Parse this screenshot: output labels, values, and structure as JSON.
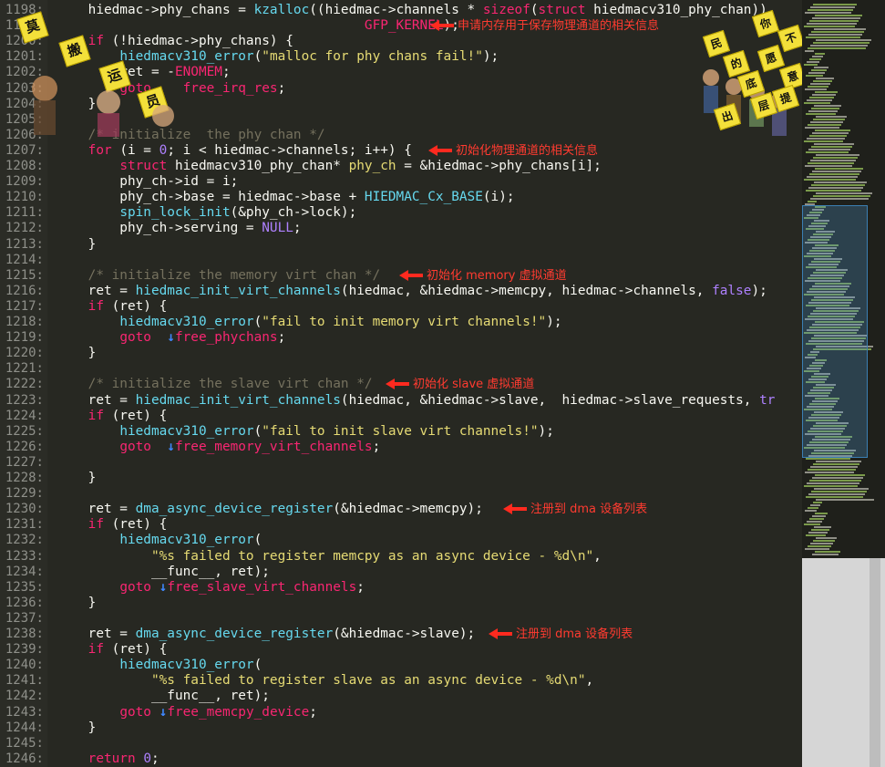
{
  "lines": [
    {
      "n": "1198:",
      "html": "    hiedmac->phy_chans = <span class='fn'>kzalloc</span>((hiedmac->channels * <span class='kw'>sizeof</span>(<span class='kw'>struct</span> hiedmacv310_phy_chan)),"
    },
    {
      "n": "1199:",
      "html": "                                       <span class='kw'>GFP_KERNEL</span>);"
    },
    {
      "n": "1200:",
      "html": "    <span class='kw'>if</span> (!hiedmac->phy_chans) {"
    },
    {
      "n": "1201:",
      "html": "        <span class='fn'>hiedmacv310_error</span>(<span class='str'>\"malloc for phy chans fail!\"</span>);"
    },
    {
      "n": "1202:",
      "html": "        ret = -<span class='kw'>ENOMEM</span>;"
    },
    {
      "n": "1203:",
      "html": "        <span class='kw'>goto</span>    <span class='lbl'>free_irq_res</span>;"
    },
    {
      "n": "1204:",
      "html": "    }"
    },
    {
      "n": "1205:",
      "html": ""
    },
    {
      "n": "1206:",
      "html": "    <span class='cm'>/* initialize  the phy chan */</span>"
    },
    {
      "n": "1207:",
      "html": "    <span class='kw'>for</span> (i = <span class='num'>0</span>; i &lt; hiedmac->channels; i++) {"
    },
    {
      "n": "1208:",
      "html": "        <span class='kw'>struct</span> hiedmacv310_phy_chan* <span class='str'>phy_ch</span> = &amp;hiedmac->phy_chans[i];"
    },
    {
      "n": "1209:",
      "html": "        phy_ch->id = i;"
    },
    {
      "n": "1210:",
      "html": "        phy_ch->base = hiedmac->base + <span class='mac'>HIEDMAC_Cx_BASE</span>(i);"
    },
    {
      "n": "1211:",
      "html": "        <span class='fn'>spin_lock_init</span>(&amp;phy_ch->lock);"
    },
    {
      "n": "1212:",
      "html": "        phy_ch->serving = <span class='cst'>NULL</span>;"
    },
    {
      "n": "1213:",
      "html": "    }"
    },
    {
      "n": "1214:",
      "html": ""
    },
    {
      "n": "1215:",
      "html": "    <span class='cm'>/* initialize the memory virt chan */</span>"
    },
    {
      "n": "1216:",
      "html": "    ret = <span class='fn'>hiedmac_init_virt_channels</span>(hiedmac, &amp;hiedmac->memcpy, hiedmac->channels, <span class='cst'>false</span>);"
    },
    {
      "n": "1217:",
      "html": "    <span class='kw'>if</span> (ret) {"
    },
    {
      "n": "1218:",
      "html": "        <span class='fn'>hiedmacv310_error</span>(<span class='str'>\"fail to init memory virt channels!\"</span>);"
    },
    {
      "n": "1219:",
      "html": "        <span class='kw'>goto</span>  <span class='gt'>↓</span><span class='lbl'>free_phychans</span>;"
    },
    {
      "n": "1220:",
      "html": "    }"
    },
    {
      "n": "1221:",
      "html": ""
    },
    {
      "n": "1222:",
      "html": "    <span class='cm'>/* initialize the slave virt chan */</span>"
    },
    {
      "n": "1223:",
      "html": "    ret = <span class='fn'>hiedmac_init_virt_channels</span>(hiedmac, &amp;hiedmac->slave,  hiedmac->slave_requests, <span class='cst'>tr</span>"
    },
    {
      "n": "1224:",
      "html": "    <span class='kw'>if</span> (ret) {"
    },
    {
      "n": "1225:",
      "html": "        <span class='fn'>hiedmacv310_error</span>(<span class='str'>\"fail to init slave virt channels!\"</span>);"
    },
    {
      "n": "1226:",
      "html": "        <span class='kw'>goto</span>  <span class='gt'>↓</span><span class='lbl'>free_memory_virt_channels</span>;"
    },
    {
      "n": "1227:",
      "html": ""
    },
    {
      "n": "1228:",
      "html": "    }"
    },
    {
      "n": "1229:",
      "html": ""
    },
    {
      "n": "1230:",
      "html": "    ret = <span class='fn'>dma_async_device_register</span>(&amp;hiedmac->memcpy);"
    },
    {
      "n": "1231:",
      "html": "    <span class='kw'>if</span> (ret) {"
    },
    {
      "n": "1232:",
      "html": "        <span class='fn'>hiedmacv310_error</span>("
    },
    {
      "n": "1233:",
      "html": "            <span class='str'>\"%s failed to register memcpy as an async device - %d\\n\"</span>,"
    },
    {
      "n": "1234:",
      "html": "            __func__, ret);"
    },
    {
      "n": "1235:",
      "html": "        <span class='kw'>goto</span> <span class='gt'>↓</span><span class='lbl'>free_slave_virt_channels</span>;"
    },
    {
      "n": "1236:",
      "html": "    }"
    },
    {
      "n": "1237:",
      "html": ""
    },
    {
      "n": "1238:",
      "html": "    ret = <span class='fn'>dma_async_device_register</span>(&amp;hiedmac->slave);"
    },
    {
      "n": "1239:",
      "html": "    <span class='kw'>if</span> (ret) {"
    },
    {
      "n": "1240:",
      "html": "        <span class='fn'>hiedmacv310_error</span>("
    },
    {
      "n": "1241:",
      "html": "            <span class='str'>\"%s failed to register slave as an async device - %d\\n\"</span>,"
    },
    {
      "n": "1242:",
      "html": "            __func__, ret);"
    },
    {
      "n": "1243:",
      "html": "        <span class='kw'>goto</span> <span class='gt'>↓</span><span class='lbl'>free_memcpy_device</span>;"
    },
    {
      "n": "1244:",
      "html": "    }"
    },
    {
      "n": "1245:",
      "html": ""
    },
    {
      "n": "1246:",
      "html": "    <span class='kw'>return</span> <span class='num'>0</span>;"
    }
  ],
  "annotations": [
    {
      "line_index": 1,
      "text": "申请内存用于保存物理通道的相关信息"
    },
    {
      "line_index": 9,
      "text": "初始化物理通道的相关信息"
    },
    {
      "line_index": 17,
      "text": "初始化  memory 虚拟通道"
    },
    {
      "line_index": 24,
      "text": "初始化  slave 虚拟通道"
    },
    {
      "line_index": 32,
      "text": "注册到  dma  设备列表"
    },
    {
      "line_index": 40,
      "text": "注册到  dma  设备列表"
    }
  ],
  "watermark_left": {
    "chars": [
      "莫",
      "搬",
      "运",
      "员"
    ]
  },
  "watermark_right": {
    "chars": [
      "你",
      "不",
      "愿",
      "意",
      "民",
      "的",
      "底",
      "层",
      "提",
      "出"
    ]
  },
  "colors": {
    "background": "#272822",
    "annotation": "#ff3b30",
    "keyword": "#f92672",
    "function": "#66d9ef",
    "string": "#e6db74",
    "comment": "#75715e"
  }
}
